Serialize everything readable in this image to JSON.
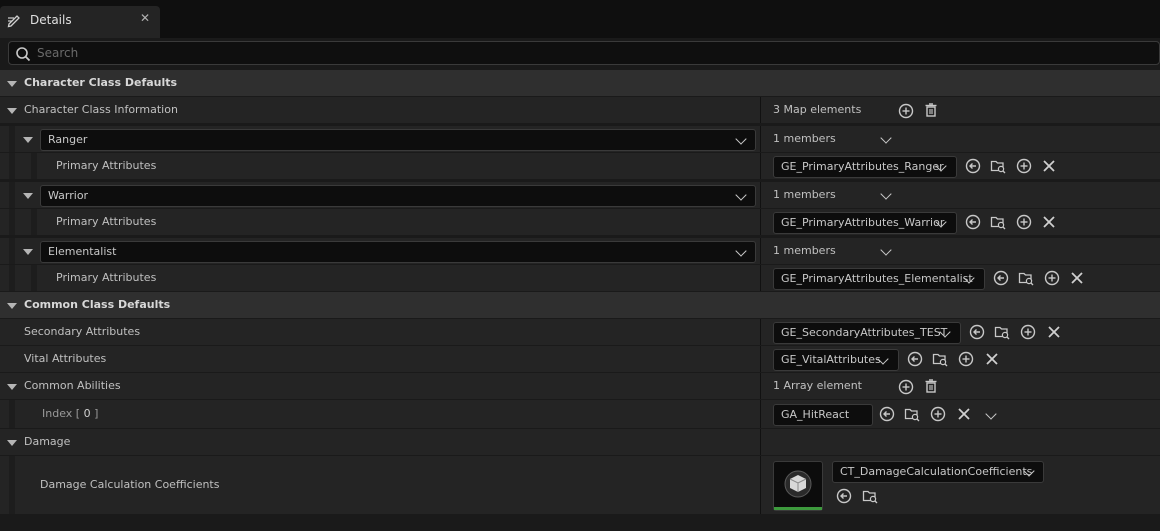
{
  "tab": {
    "title": "Details"
  },
  "search": {
    "placeholder": "Search"
  },
  "sections": {
    "character_class_defaults": "Character Class Defaults",
    "character_class_information": "Character Class Information",
    "map_elements": "3 Map elements",
    "common_class_defaults": "Common Class Defaults",
    "damage": "Damage"
  },
  "classes": [
    {
      "key": "Ranger",
      "members": "1 members",
      "attr_label": "Primary Attributes",
      "value": "GE_PrimaryAttributes_Ranger"
    },
    {
      "key": "Warrior",
      "members": "1 members",
      "attr_label": "Primary Attributes",
      "value": "GE_PrimaryAttributes_Warrior"
    },
    {
      "key": "Elementalist",
      "members": "1 members",
      "attr_label": "Primary Attributes",
      "value": "GE_PrimaryAttributes_Elementalist"
    }
  ],
  "common": {
    "secondary_label": "Secondary Attributes",
    "secondary_value": "GE_SecondaryAttributes_TEST",
    "vital_label": "Vital Attributes",
    "vital_value": "GE_VitalAttributes",
    "abilities_label": "Common Abilities",
    "abilities_count": "1 Array element",
    "index_label": "Index",
    "index_num": "0",
    "index_value": "GA_HitReact"
  },
  "damage": {
    "label": "Damage Calculation Coefficients",
    "value": "CT_DamageCalculationCoefficients"
  },
  "colors": {
    "annotation": "#cc1111",
    "thumb_accent": "#3d9a3d"
  }
}
